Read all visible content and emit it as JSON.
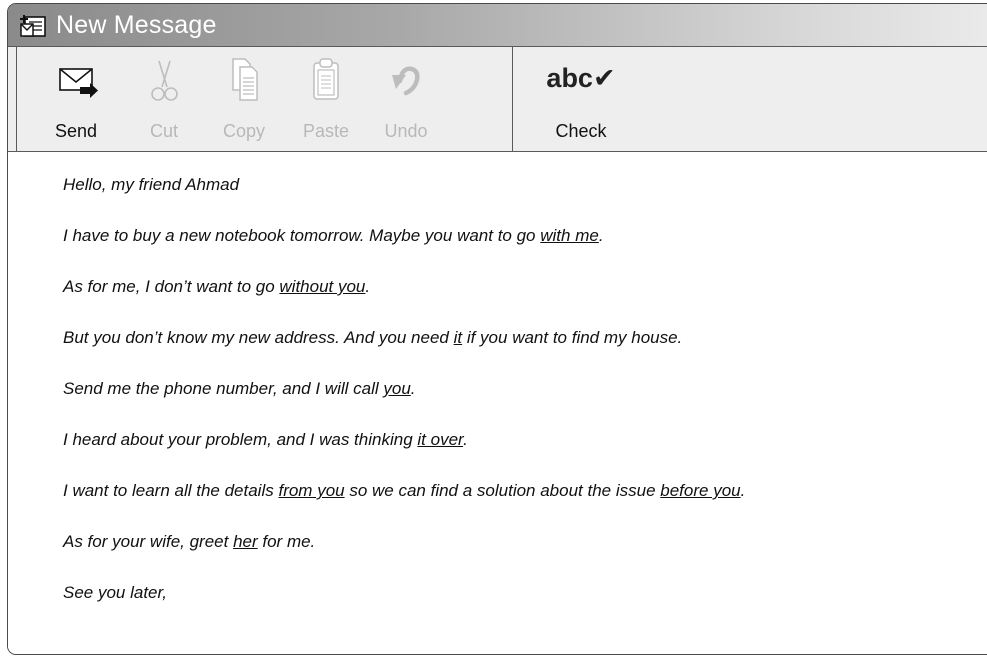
{
  "window": {
    "title": "New Message"
  },
  "toolbar": {
    "buttons": [
      {
        "label": "Send",
        "icon": "send-envelope-icon",
        "enabled": true
      },
      {
        "label": "Cut",
        "icon": "scissors-icon",
        "enabled": false
      },
      {
        "label": "Copy",
        "icon": "copy-icon",
        "enabled": false
      },
      {
        "label": "Paste",
        "icon": "clipboard-icon",
        "enabled": false
      },
      {
        "label": "Undo",
        "icon": "undo-icon",
        "enabled": false
      }
    ],
    "check": {
      "glyph": "abc✔",
      "label": "Check",
      "icon": "spellcheck-icon"
    }
  },
  "message": {
    "lines": [
      {
        "parts": [
          {
            "t": "Hello, my friend Ahmad"
          }
        ]
      },
      {
        "parts": [
          {
            "t": "I have to buy a new notebook tomorrow.  Maybe you want to go "
          },
          {
            "t": "with me",
            "u": true
          },
          {
            "t": "."
          }
        ]
      },
      {
        "parts": [
          {
            "t": "As for me, I don’t want to go "
          },
          {
            "t": "without you",
            "u": true
          },
          {
            "t": "."
          }
        ]
      },
      {
        "parts": [
          {
            "t": "But you don’t know my new address.  And you need "
          },
          {
            "t": "it",
            "u": true
          },
          {
            "t": " if you want to find my house."
          }
        ]
      },
      {
        "parts": [
          {
            "t": "Send me the phone number, and I will call "
          },
          {
            "t": "you",
            "u": true
          },
          {
            "t": "."
          }
        ]
      },
      {
        "parts": [
          {
            "t": "I heard about your problem, and I was thinking "
          },
          {
            "t": "it over",
            "u": true
          },
          {
            "t": "."
          }
        ]
      },
      {
        "parts": [
          {
            "t": "I want to learn all the details "
          },
          {
            "t": "from you",
            "u": true
          },
          {
            "t": " so we can find a solution about the issue "
          },
          {
            "t": "before you",
            "u": true
          },
          {
            "t": "."
          }
        ]
      },
      {
        "parts": [
          {
            "t": "As for your wife, greet "
          },
          {
            "t": "her",
            "u": true
          },
          {
            "t": " for me."
          }
        ]
      },
      {
        "parts": [
          {
            "t": "See you later,"
          }
        ]
      }
    ]
  },
  "colors": {
    "disabled_text": "#b8b8b8",
    "border": "#5a5a5a"
  }
}
